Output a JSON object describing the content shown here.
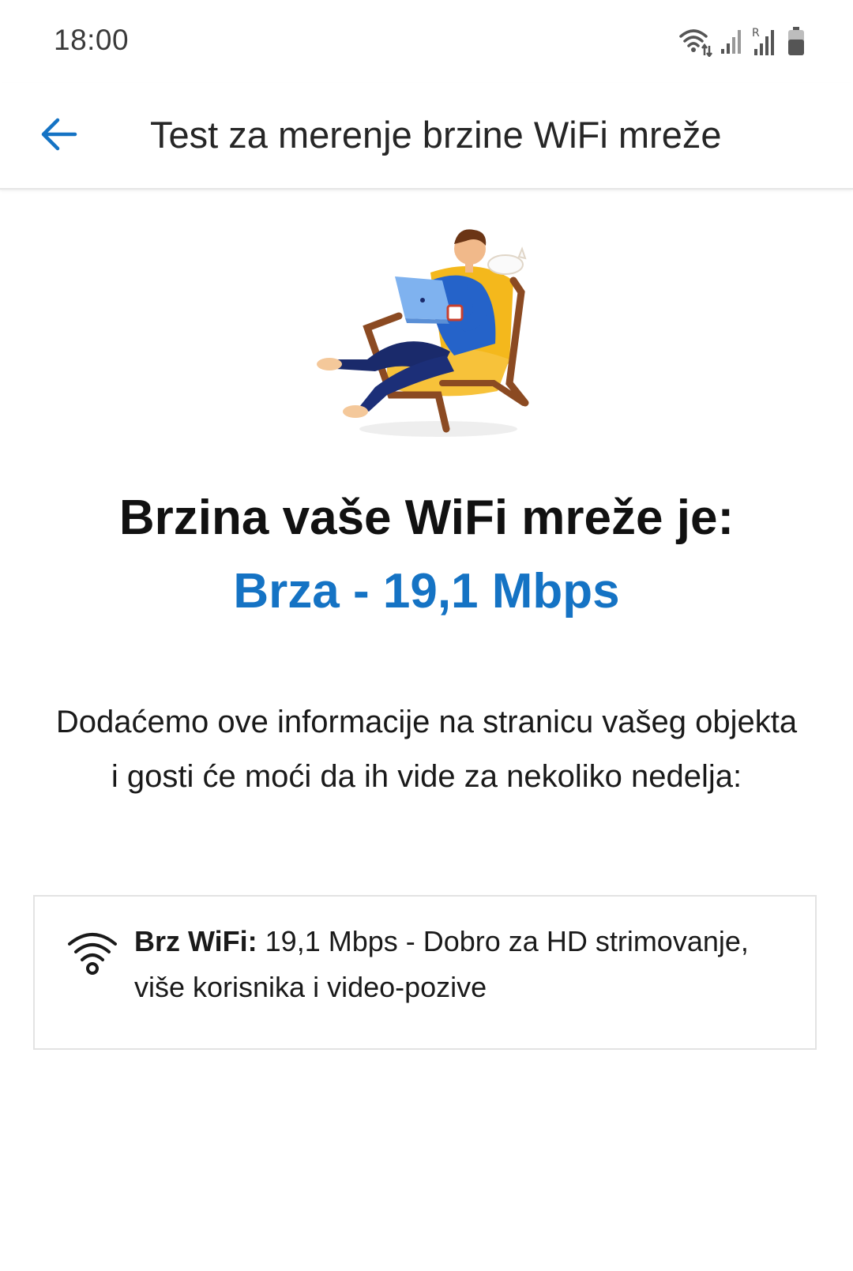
{
  "status_bar": {
    "time": "18:00",
    "icons": [
      "wifi-data-icon",
      "signal-icon",
      "roaming-signal-icon",
      "battery-icon"
    ]
  },
  "app_bar": {
    "back_icon": "arrow-left-icon",
    "title": "Test za merenje brzine WiFi mreže",
    "accent_color": "#1573c4"
  },
  "illustration": {
    "subject": "person-in-armchair-with-laptop"
  },
  "result": {
    "headline": "Brzina vaše WiFi mreže je:",
    "speed": "Brza - 19,1 Mbps",
    "speed_color": "#1573c4"
  },
  "description": "Dodaćemo ove informacije na stranicu vašeg objekta i gosti će moći da ih vide za nekoliko nedelja:",
  "info_card": {
    "icon": "wifi-icon",
    "label": "Brz WiFi:",
    "text": " 19,1 Mbps - Dobro za HD strimovanje, više korisnika i video-pozive"
  }
}
